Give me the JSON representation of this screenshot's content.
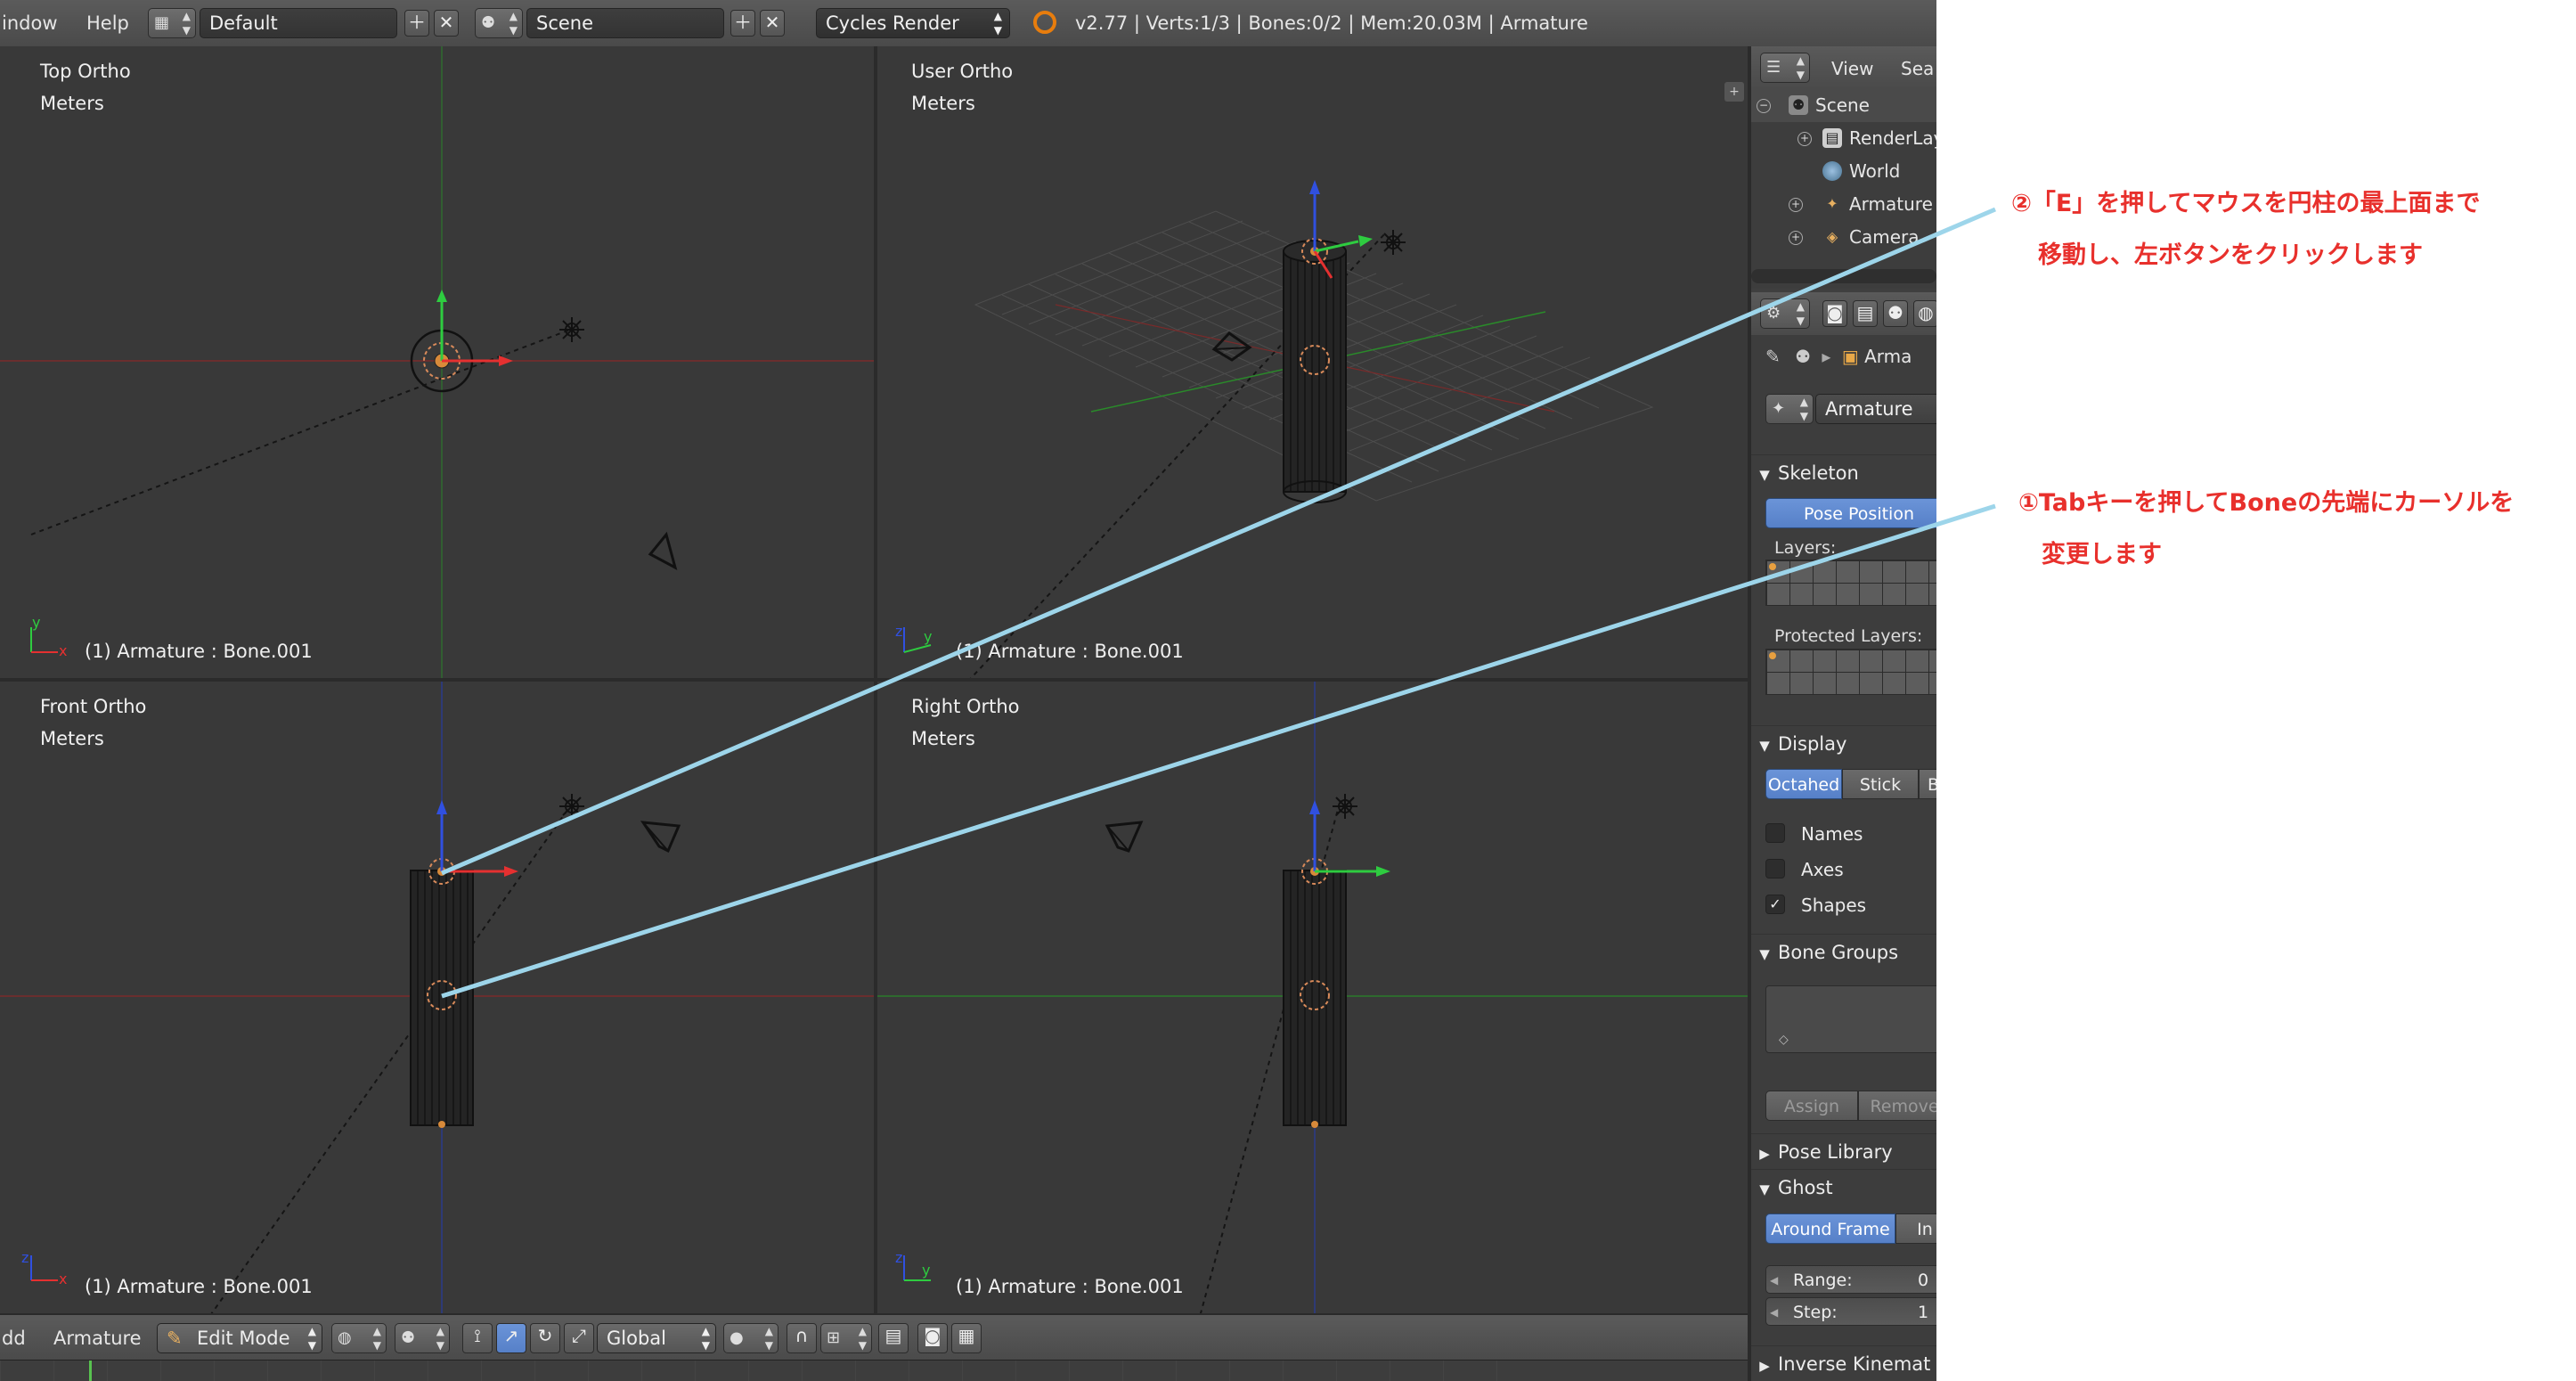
{
  "topbar": {
    "menu_window": "indow",
    "menu_help": "Help",
    "screen_layout": "Default",
    "scene": "Scene",
    "render_engine": "Cycles Render",
    "stats": "v2.77 | Verts:1/3 | Bones:0/2 | Mem:20.03M | Armature"
  },
  "viewports": {
    "top_left": {
      "view": "Top Ortho",
      "units": "Meters",
      "footer": "(1) Armature : Bone.001"
    },
    "top_right": {
      "view": "User Ortho",
      "units": "Meters",
      "footer": "(1) Armature : Bone.001"
    },
    "bottom_left": {
      "view": "Front Ortho",
      "units": "Meters",
      "footer": "(1) Armature : Bone.001"
    },
    "bottom_right": {
      "view": "Right Ortho",
      "units": "Meters",
      "footer": "(1) Armature : Bone.001"
    }
  },
  "bottombar": {
    "menu_add": "dd",
    "menu_armature": "Armature",
    "mode": "Edit Mode",
    "orientation": "Global"
  },
  "outliner": {
    "view_menu": "View",
    "search_menu": "Sea",
    "items": [
      {
        "label": "Scene"
      },
      {
        "label": "RenderLay"
      },
      {
        "label": "World"
      },
      {
        "label": "Armature"
      },
      {
        "label": "Camera"
      }
    ]
  },
  "properties": {
    "breadcrumb": "Arma",
    "datablock": "Armature",
    "skeleton": {
      "title": "Skeleton",
      "pose_position": "Pose Position",
      "layers": "Layers:",
      "protected_layers": "Protected Layers:"
    },
    "display": {
      "title": "Display",
      "octahedral": "Octahed",
      "stick": "Stick",
      "bbone": "B-",
      "names": "Names",
      "axes": "Axes",
      "shapes": "Shapes",
      "shapes_checked": true
    },
    "bone_groups": {
      "title": "Bone Groups",
      "assign": "Assign",
      "remove": "Remove"
    },
    "pose_library": "Pose Library",
    "ghost": {
      "title": "Ghost",
      "around_frame": "Around Frame",
      "in_range": "In",
      "range_label": "Range:",
      "range_value": "0",
      "step_label": "Step:",
      "step_value": "1"
    },
    "inverse_kinematics": "Inverse Kinemat"
  },
  "annotations": {
    "step2_line1": "②「E」を押してマウスを円柱の最上面まで",
    "step2_line2": "移動し、左ボタンをクリックします",
    "step1_line1": "①Tabキーを押してBoneの先端にカーソルを",
    "step1_line2": "変更します"
  },
  "colors": {
    "background": "#393939",
    "panel": "#3f3f3f",
    "highlight_blue": "#5680c8",
    "annotation_red": "#e8302c",
    "annotation_line": "#9dd5ea"
  }
}
